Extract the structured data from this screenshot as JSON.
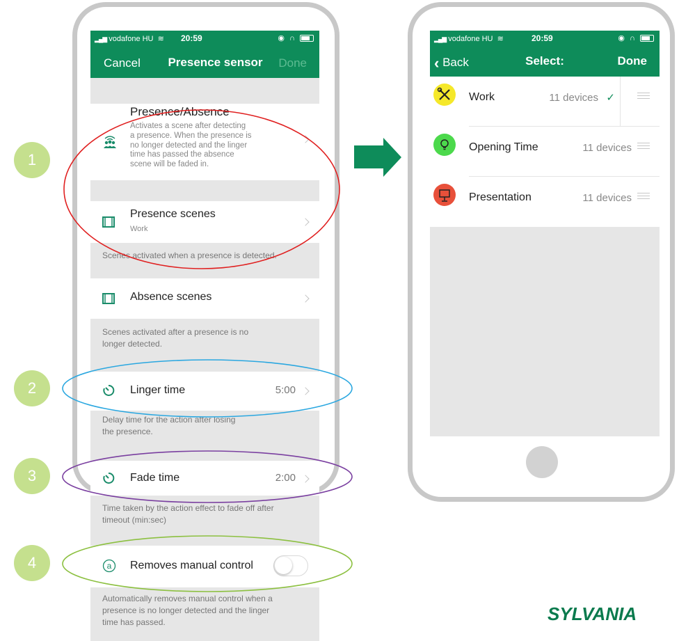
{
  "colors": {
    "accent_green": "#0e8c5a",
    "number_badge": "#c5e08e",
    "ellipse_1": "#e02020",
    "ellipse_2": "#2aa7e0",
    "ellipse_3": "#7a3fa0",
    "ellipse_4": "#8cc040"
  },
  "left_phone": {
    "status": {
      "carrier": "vodafone HU",
      "time": "20:59"
    },
    "nav": {
      "cancel": "Cancel",
      "title": "Presence sensor",
      "done": "Done"
    },
    "presence_absence": {
      "title": "Presence/Absence",
      "description_lines": [
        "Activates a scene after detecting",
        "a presence. When the presence is",
        "no longer detected and the linger",
        "time has passed the absence",
        "scene will be faded in."
      ],
      "icon": "people-sensor-icon"
    },
    "presence_scenes": {
      "title": "Presence scenes",
      "value": "Work",
      "footer": "Scenes activated when a presence is detected.",
      "icon": "film-icon"
    },
    "absence_scenes": {
      "title": "Absence scenes",
      "footer_lines": [
        "Scenes activated after a presence is no",
        "longer detected."
      ],
      "icon": "film-icon"
    },
    "linger_time": {
      "title": "Linger time",
      "value": "5:00",
      "footer_lines": [
        "Delay time for the action after losing",
        "the presence."
      ],
      "icon": "timer-icon"
    },
    "fade_time": {
      "title": "Fade time",
      "value": "2:00",
      "footer_lines": [
        "Time taken by the action effect to fade off after",
        "timeout (min:sec)"
      ],
      "icon": "timer-icon"
    },
    "manual_control": {
      "title": "Removes manual control",
      "toggle_on": false,
      "footer_lines": [
        "Automatically removes manual control when a",
        "presence is no longer detected and the linger",
        "time has passed."
      ],
      "icon": "circled-a-icon"
    }
  },
  "badges": [
    "1",
    "2",
    "3",
    "4"
  ],
  "right_phone": {
    "status": {
      "carrier": "vodafone HU",
      "time": "20:59"
    },
    "nav": {
      "back": "Back",
      "title": "Select:",
      "done": "Done"
    },
    "scenes": [
      {
        "label": "Work",
        "count": "11 devices",
        "selected": true,
        "icon": "tools-icon",
        "color": "#f5e82a"
      },
      {
        "label": "Opening Time",
        "count": "11 devices",
        "selected": false,
        "icon": "lightbulb-icon",
        "color": "#4cd94c"
      },
      {
        "label": "Presentation",
        "count": "11 devices",
        "selected": false,
        "icon": "presentation-icon",
        "color": "#e8503a"
      }
    ]
  },
  "brand": {
    "logo_text": "SYLVANIA"
  }
}
